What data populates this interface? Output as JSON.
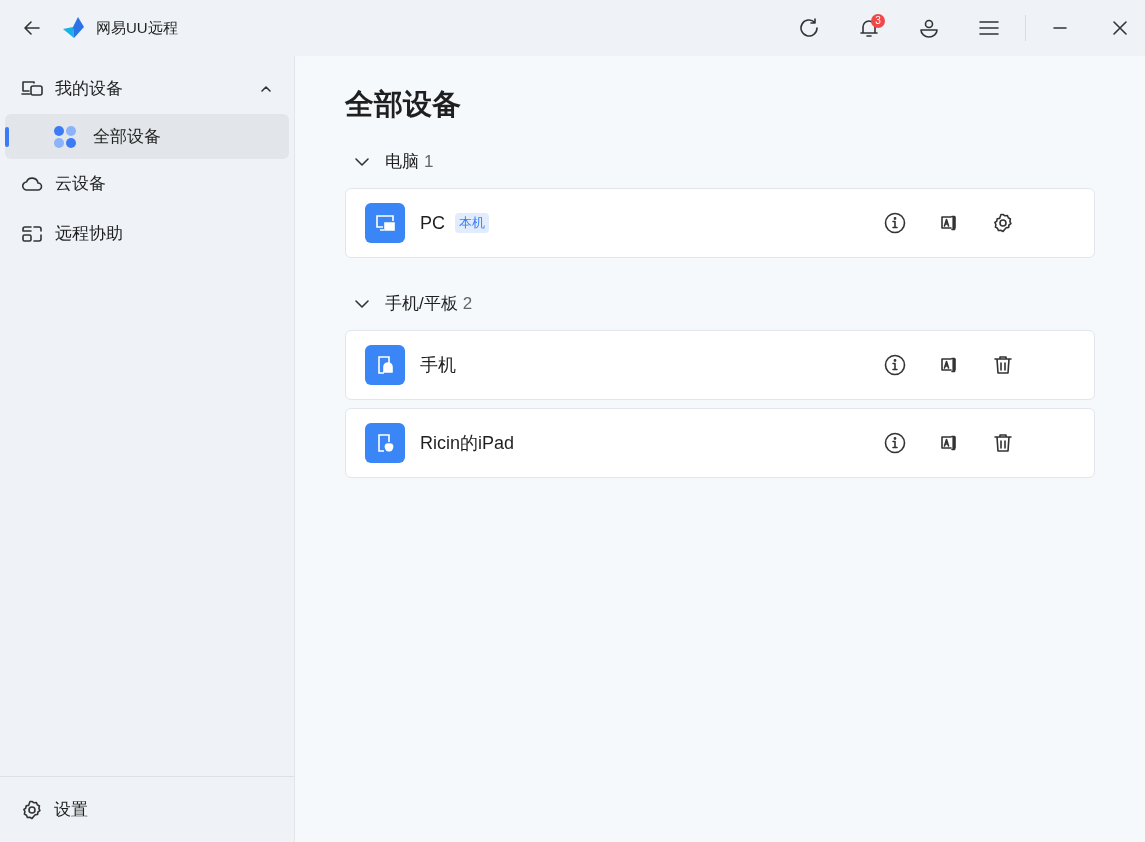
{
  "app": {
    "title": "网易UU远程",
    "notification_count": "3"
  },
  "sidebar": {
    "items": [
      {
        "label": "我的设备",
        "kind": "devices",
        "selected": false,
        "expanded": true,
        "children": [
          {
            "label": "全部设备",
            "selected": true
          }
        ]
      },
      {
        "label": "云设备",
        "kind": "cloud",
        "selected": false
      },
      {
        "label": "远程协助",
        "kind": "assist",
        "selected": false
      }
    ],
    "footer": {
      "label": "设置"
    }
  },
  "main": {
    "title": "全部设备",
    "groups": [
      {
        "label": "电脑",
        "count": "1",
        "expanded": true,
        "devices": [
          {
            "name": "PC",
            "kind": "pc",
            "badge": "本机",
            "actions": [
              {
                "kind": "info"
              },
              {
                "kind": "rename"
              },
              {
                "kind": "settings"
              }
            ]
          }
        ]
      },
      {
        "label": "手机/平板",
        "count": "2",
        "expanded": true,
        "devices": [
          {
            "name": "手机",
            "kind": "android",
            "actions": [
              {
                "kind": "info"
              },
              {
                "kind": "rename"
              },
              {
                "kind": "delete"
              }
            ]
          },
          {
            "name": "Ricin的iPad",
            "kind": "apple",
            "actions": [
              {
                "kind": "info"
              },
              {
                "kind": "rename"
              },
              {
                "kind": "delete"
              }
            ]
          }
        ]
      }
    ]
  }
}
